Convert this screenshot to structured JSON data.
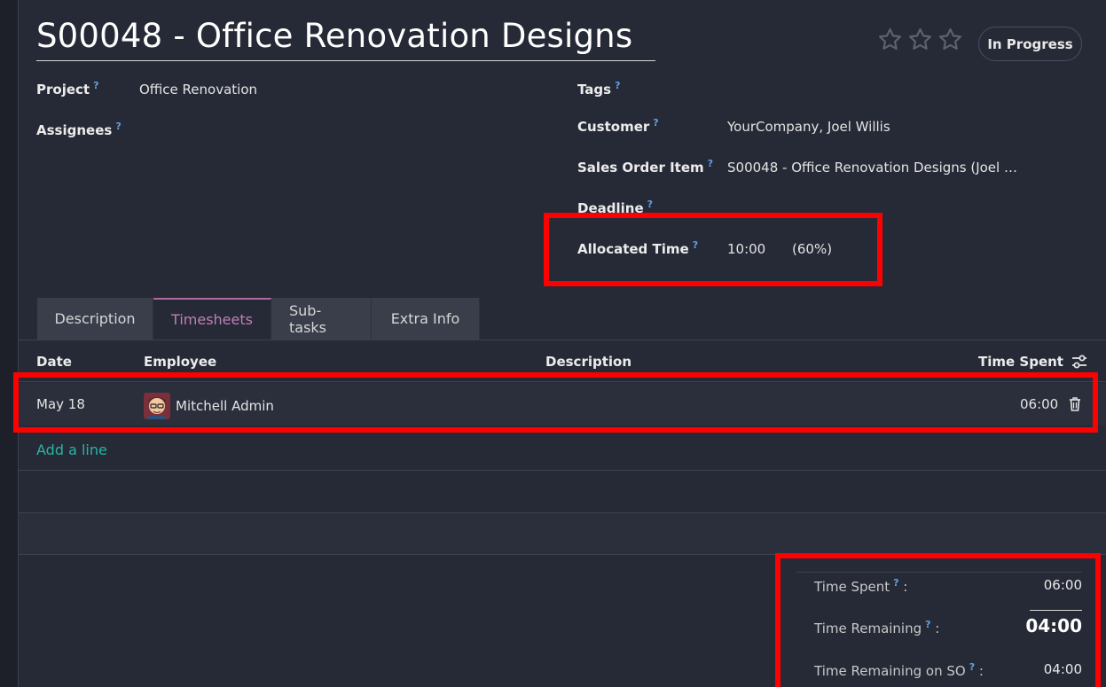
{
  "task": {
    "title": "S00048 - Office Renovation Designs",
    "status": "In Progress",
    "stars": 3,
    "help_mark": "?"
  },
  "fields": {
    "project": {
      "label": "Project",
      "value": "Office Renovation"
    },
    "assignees": {
      "label": "Assignees",
      "value": ""
    },
    "tags": {
      "label": "Tags",
      "value": ""
    },
    "customer": {
      "label": "Customer",
      "value": "YourCompany, Joel Willis"
    },
    "sales_order_item": {
      "label": "Sales Order Item",
      "value": "S00048 - Office Renovation Designs (Joel …"
    },
    "deadline": {
      "label": "Deadline",
      "value": ""
    },
    "allocated_time": {
      "label": "Allocated Time",
      "value": "10:00",
      "percent": "(60%)"
    }
  },
  "tabs": [
    {
      "label": "Description",
      "active": false
    },
    {
      "label": "Timesheets",
      "active": true
    },
    {
      "label": "Sub-tasks",
      "active": false
    },
    {
      "label": "Extra Info",
      "active": false
    }
  ],
  "timesheet": {
    "headers": {
      "date": "Date",
      "employee": "Employee",
      "description": "Description",
      "time_spent": "Time Spent"
    },
    "rows": [
      {
        "date": "May 18",
        "employee": "Mitchell Admin",
        "description": "",
        "time_spent": "06:00"
      }
    ],
    "add_line": "Add a line"
  },
  "summary": {
    "time_spent": {
      "label": "Time Spent",
      "value": "06:00"
    },
    "time_remaining": {
      "label": "Time Remaining",
      "value": "04:00"
    },
    "time_remaining_so": {
      "label": "Time Remaining on SO",
      "value": "04:00"
    }
  },
  "colors": {
    "background": "#262a36",
    "accent_tab": "#c07fb6",
    "link": "#29b4a3",
    "help": "#63a1e0",
    "highlight": "#ff0000"
  },
  "icons": {
    "star": "star-outline-icon",
    "settings": "sliders-icon",
    "delete": "trash-icon",
    "avatar": "user-avatar"
  }
}
